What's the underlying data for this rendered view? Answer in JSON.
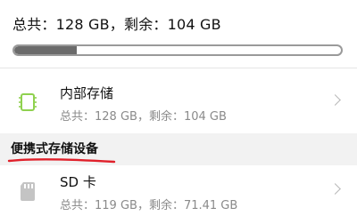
{
  "summary": {
    "text": "总共：128 GB，剩余：104 GB"
  },
  "overall_usage": {
    "used_fraction": 0.19
  },
  "internal_storage": {
    "title": "内部存储",
    "detail": "总共：128 GB，剩余：104 GB",
    "icon": "chip-icon",
    "icon_color": "#8fd14f"
  },
  "portable_section": {
    "title": "便携式存储设备",
    "underline_color": "#e0202a"
  },
  "sd_card": {
    "title": "SD 卡",
    "detail": "总共：119 GB，剩余：71.41 GB",
    "icon": "sd-card-icon"
  }
}
